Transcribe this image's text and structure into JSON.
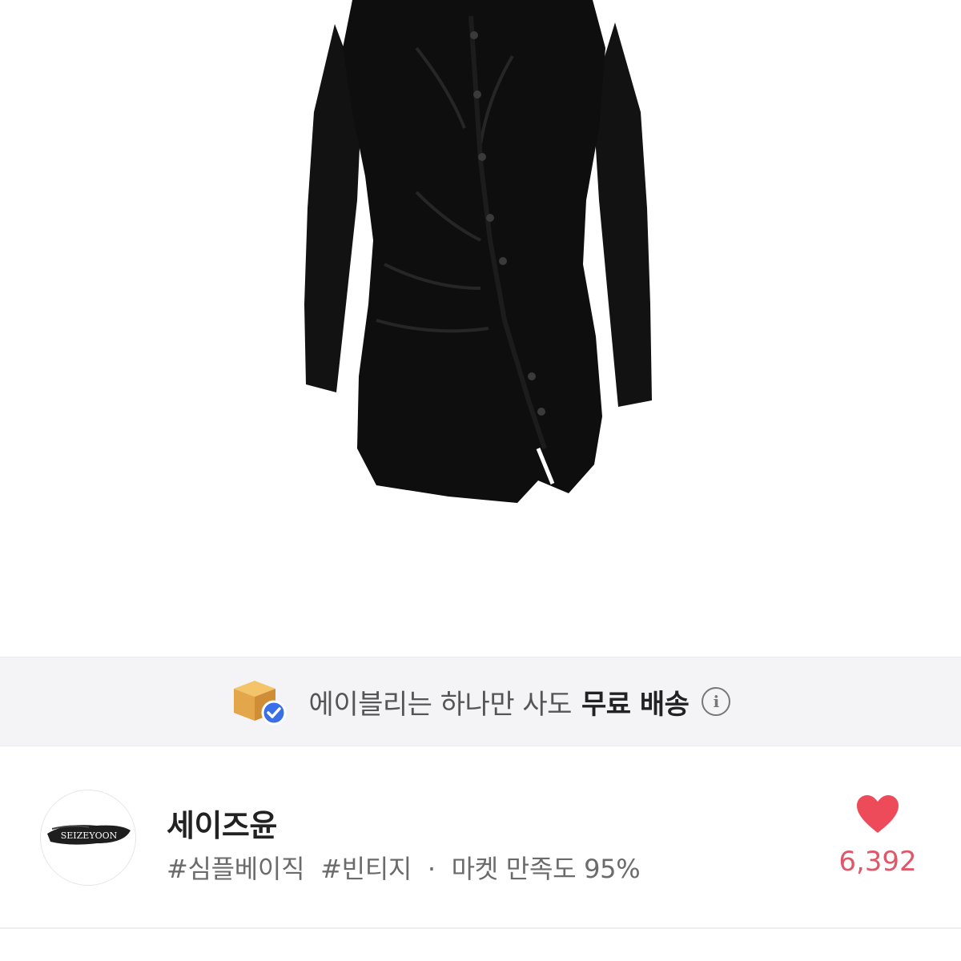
{
  "shipping_banner": {
    "text": "에이블리는 하나만 사도",
    "emphasis": "무료 배송",
    "icon": "box-check-icon",
    "info_icon": "info-icon"
  },
  "seller": {
    "logo_text": "SEIZEYOON",
    "name": "세이즈윤",
    "tags": [
      "#심플베이직",
      "#빈티지"
    ],
    "separator": "·",
    "satisfaction": "마켓 만족도 95%",
    "likes": "6,392"
  },
  "colors": {
    "heart": "#ee4b5a",
    "like_count": "#e0576a",
    "banner_bg": "#f4f4f6",
    "check_badge": "#3a6fe8"
  }
}
